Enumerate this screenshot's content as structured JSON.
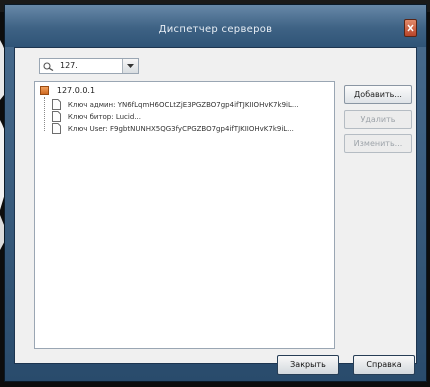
{
  "window": {
    "title": "Диспетчер серверов"
  },
  "server_combo": {
    "value": "127.",
    "icon": "search-icon"
  },
  "tree": {
    "root_label": "127.0.0.1",
    "children": [
      "Ключ админ: YN6fLqmH6OCLtZjE3PGZBO7gp4ifTJKIIOHvK7k9iL...",
      "Ключ битор: Lucid...",
      "Ключ User: F9gbtNUNHX5QG3fyCPGZBO7gp4ifTJKIIOHvK7k9iL..."
    ]
  },
  "side_buttons": {
    "add": "Добавить...",
    "delete": "Удалить",
    "change": "Изменить..."
  },
  "footer": {
    "close": "Закрыть",
    "help": "Справка"
  },
  "colors": {
    "titlebar": "#3e6284",
    "frame": "#294b6c",
    "client": "#f0f0f0",
    "root_icon": "#d06a22",
    "close_button": "#b8452a"
  }
}
